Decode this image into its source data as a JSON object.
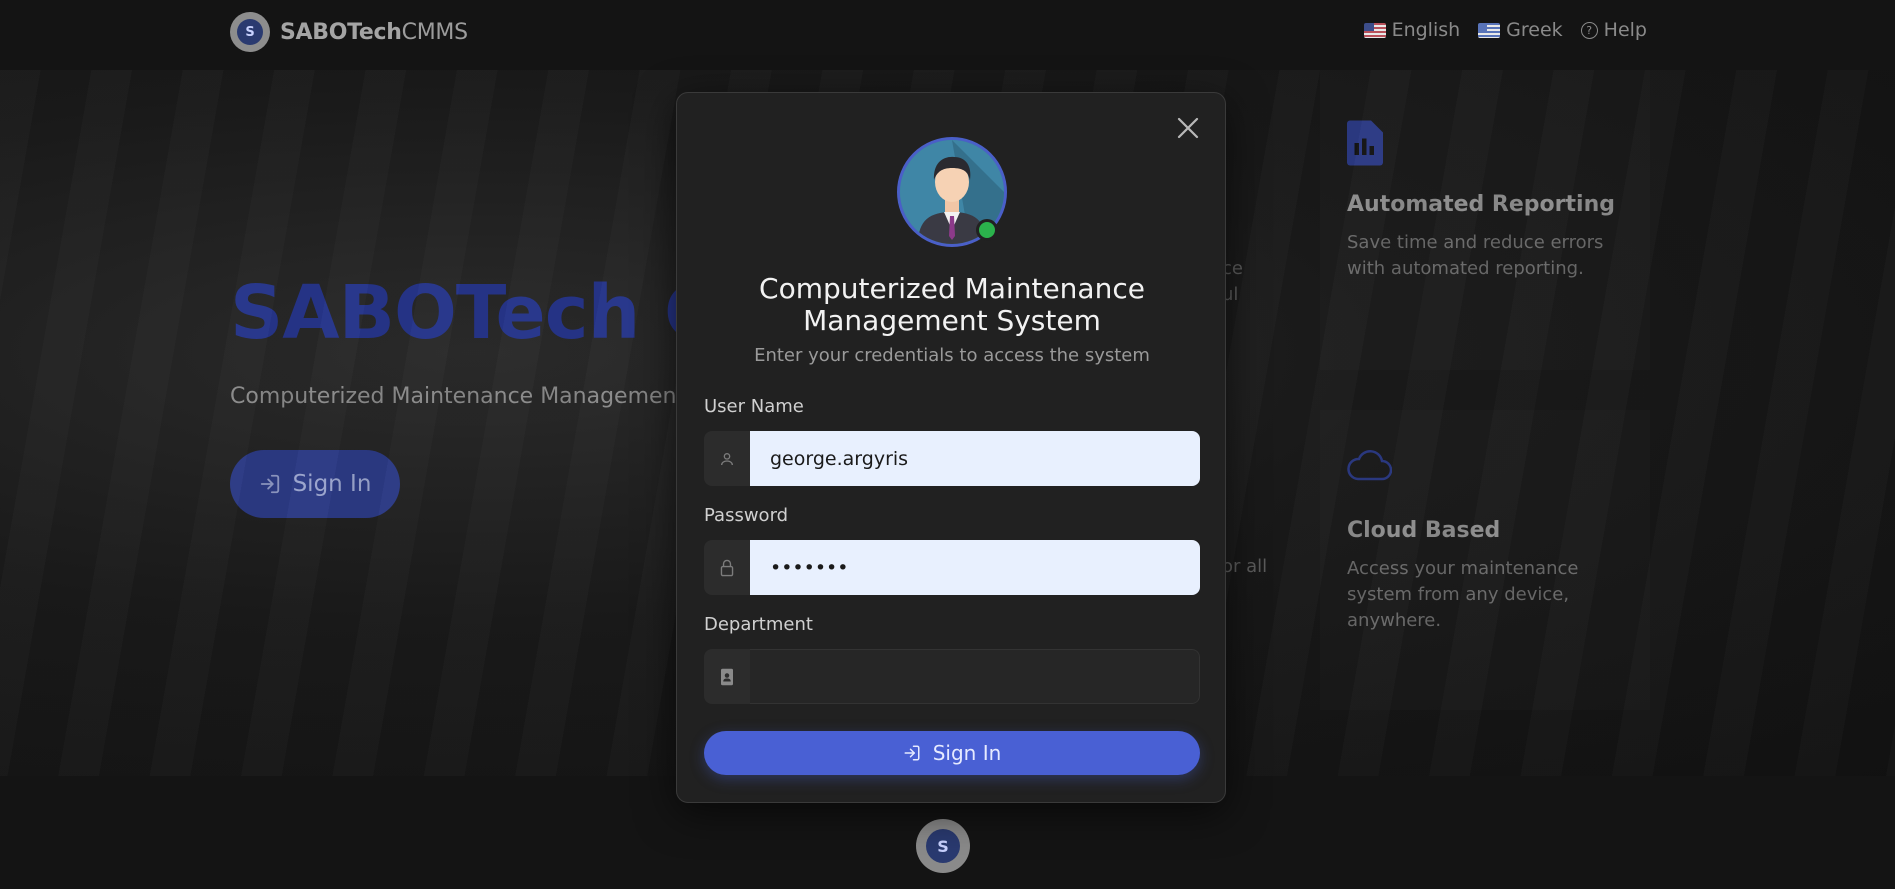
{
  "nav": {
    "brand_bold": "SABOTech",
    "brand_light": "CMMS",
    "lang_english": "English",
    "lang_greek": "Greek",
    "help": "Help"
  },
  "hero": {
    "title": "SABOTech C",
    "subtitle": "Computerized Maintenance Management",
    "signin_label": "Sign In"
  },
  "features": {
    "reporting_title": "Automated Reporting",
    "reporting_desc": "Save time and reduce errors with automated reporting.",
    "cloud_title": "Cloud Based",
    "cloud_desc": "Access your maintenance system from any device, anywhere.",
    "partial_1a": "ce",
    "partial_1b": "ul",
    "partial_2": "or all"
  },
  "modal": {
    "title": "Computerized Maintenance Management System",
    "subtitle": "Enter your credentials to access the system",
    "username_label": "User Name",
    "username_value": "george.argyris",
    "password_label": "Password",
    "password_value": "•••••••",
    "department_label": "Department",
    "department_value": "",
    "signin_label": "Sign In"
  },
  "colors": {
    "accent": "#4960d4",
    "status_online": "#2bb24c"
  }
}
